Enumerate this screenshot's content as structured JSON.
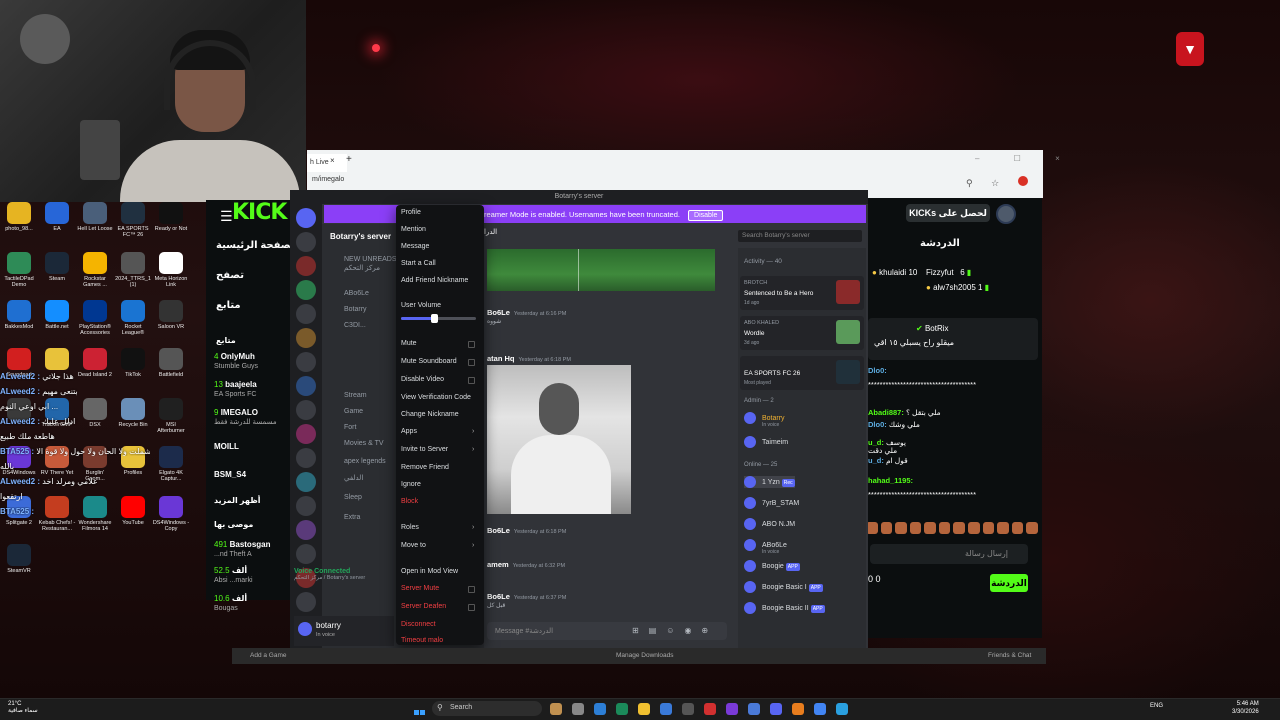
{
  "stream_overlay": {
    "corner_badge": "▼"
  },
  "desktop_icons": [
    {
      "label": "photo_98...",
      "color": "#e6b422"
    },
    {
      "label": "EA",
      "color": "#2766d8"
    },
    {
      "label": "Hell Let Loose",
      "color": "#4a5f7a"
    },
    {
      "label": "EA SPORTS FC™ 26",
      "color": "#203040"
    },
    {
      "label": "Ready or Not",
      "color": "#111111"
    },
    {
      "label": "TactileDPad Demo",
      "color": "#2e8b57"
    },
    {
      "label": "Steam",
      "color": "#1b2838"
    },
    {
      "label": "Rockstar Games ...",
      "color": "#f5b400"
    },
    {
      "label": "2024_TTRS_1 (1)",
      "color": "#555555"
    },
    {
      "label": "Meta Horizon Link",
      "color": "#ffffff"
    },
    {
      "label": "BakkesMod",
      "color": "#1f6fd1"
    },
    {
      "label": "Battle.net",
      "color": "#148eff"
    },
    {
      "label": "PlayStation® Accessories",
      "color": "#003791"
    },
    {
      "label": "Rocket League®",
      "color": "#1a74d2"
    },
    {
      "label": "Saloon VR",
      "color": "#333333"
    },
    {
      "label": "Soundpad",
      "color": "#d21f1f"
    },
    {
      "label": "",
      "color": "#e8c23a"
    },
    {
      "label": "Dead Island 2",
      "color": "#cc2233"
    },
    {
      "label": "TikTok",
      "color": "#111111"
    },
    {
      "label": "Battlefield",
      "color": "#555555"
    },
    {
      "label": "",
      "color": "#3a3a3a"
    },
    {
      "label": "TrackerGMP",
      "color": "#2266aa"
    },
    {
      "label": "DSX",
      "color": "#666666"
    },
    {
      "label": "Recycle Bin",
      "color": "#6a8fb8"
    },
    {
      "label": "MSI Afterburner",
      "color": "#202020"
    },
    {
      "label": "DS4Windows",
      "color": "#6a37d6"
    },
    {
      "label": "RV There Yet",
      "color": "#c85a3a"
    },
    {
      "label": "Burglin' Gnom...",
      "color": "#7a3b2e"
    },
    {
      "label": "Profiles",
      "color": "#e8c23a"
    },
    {
      "label": "Elgato 4K Captur...",
      "color": "#1c2b4b"
    },
    {
      "label": "Splitgate 2",
      "color": "#3c6bd8"
    },
    {
      "label": "Kebab Chefs! - Restauran...",
      "color": "#c43d1f"
    },
    {
      "label": "Wondershare Filmora 14",
      "color": "#1b8a8a"
    },
    {
      "label": "YouTube",
      "color": "#ff0000"
    },
    {
      "label": "DS4Windows - Copy",
      "color": "#6a37d6"
    },
    {
      "label": "SteamVR",
      "color": "#1b2838"
    }
  ],
  "left_chat": [
    {
      "user": "ALweed2 :",
      "text": "هذا جلاتي"
    },
    {
      "user": "ALweed2 :",
      "text": "بتنعى مهيم"
    },
    {
      "user": "",
      "text": "ابي اوعي النوم ..."
    },
    {
      "user": "ALweed2 :",
      "text": "ادلل عليك"
    },
    {
      "user": "",
      "text": "هاطعة ملك طبيع"
    },
    {
      "user": "BTA525 :",
      "text": "لا شملت ولا الحان ولا حول ولا قوة الا"
    },
    {
      "user": "",
      "text": "بالله"
    },
    {
      "user": "ALweed2 :",
      "text": "علامي ومرلد اخد"
    },
    {
      "user": "",
      "text": "ارتقعوا"
    },
    {
      "user": "BTA525 :",
      "text": ""
    }
  ],
  "kick": {
    "logo": "KICK",
    "menu_icon": "☰",
    "nav": [
      "الصفحة الرئيسية",
      "تصفح",
      "متابع"
    ],
    "following_header": "متابع",
    "streams": [
      {
        "count": "4",
        "name": "OnlyMuh",
        "game": "Stumble Guys"
      },
      {
        "count": "13",
        "name": "baajeela",
        "game": "EA Sports FC"
      },
      {
        "count": "9",
        "name": "IMEGALO",
        "game": "مسمسة للدرشة فقط"
      },
      {
        "count": "",
        "name": "MOILL",
        "game": ""
      },
      {
        "count": "",
        "name": "BSM_S4",
        "game": ""
      },
      {
        "count": "",
        "name": "أظهر المزيد",
        "game": ""
      },
      {
        "count": "",
        "name": "موصى بها",
        "game": ""
      },
      {
        "count": "491",
        "name": "Bastosgan",
        "game": "...nd Theft A"
      },
      {
        "count": "52.5",
        "name": "ألف",
        "game": "Absi ...marki"
      },
      {
        "count": "10.6",
        "name": "ألف",
        "game": "Bougas"
      }
    ]
  },
  "browser": {
    "tab_label": "h Live",
    "tab_close": "×",
    "new_tab": "+",
    "address": "m/imegalo",
    "win_controls": "– ☐ ×",
    "toolbar_icons": [
      "⚲",
      "☆"
    ]
  },
  "kick_right": {
    "top_button": "KICKs لحصل على",
    "chat_title": "الدردشة",
    "leaders": [
      {
        "name": "khulaidi",
        "value": "10"
      },
      {
        "name": "Fizzyfut",
        "value": "6"
      },
      {
        "name": "alw7sh2005",
        "value": "1"
      }
    ],
    "pinned_user": "BotRix",
    "pinned_text": "ميقلو راح يسبلي ١٥ اقي",
    "messages": [
      {
        "user": "Dlo0:",
        "text": ""
      },
      {
        "user": "",
        "text": "*************************************"
      },
      {
        "user": "Abadi887:",
        "text": "ملي بتقل ؟"
      },
      {
        "user": "Dlo0:",
        "text": "ملي وشك"
      },
      {
        "user": "u_d:",
        "text": "يوسف"
      },
      {
        "user": "",
        "text": "ملي دقت"
      },
      {
        "user": "u_d:",
        "text": "قول ام"
      },
      {
        "user": "hahad_1195:",
        "text": ""
      },
      {
        "user": "",
        "text": "*************************************"
      }
    ],
    "input_placeholder": "إرسال رسالة",
    "bottom_stats": "0   0",
    "chat_button": "الدردشة"
  },
  "discord": {
    "window_title": "Botarry's server",
    "banner_text": "reamer Mode is enabled. Usernames have been truncated.",
    "banner_button": "Disable",
    "server_name": "Botarry's server",
    "channels": [
      "مركز التحكم",
      "NEW UNREADS",
      "ABo6Le",
      "Botarry",
      "C3DI...",
      "Stream",
      "Game",
      "Fort",
      "Movies & TV",
      "apex legends",
      "الدلفي",
      "Sleep",
      "Extra"
    ],
    "voice_connected": "Voice Connected",
    "voice_sub": "مركز التحكم / Botarry's server",
    "user_name": "botarry",
    "user_status": "In voice",
    "channel_head": "الدرا",
    "search_placeholder": "Search Botarry's server",
    "messages": [
      {
        "author": "Bo6Le",
        "time": "Yesterday at 6:16 PM",
        "text": "شووه"
      },
      {
        "author": "atan Hq",
        "time": "Yesterday at 6:18 PM",
        "text": ""
      },
      {
        "author": "Bo6Le",
        "time": "Yesterday at 6:18 PM",
        "text": ""
      },
      {
        "author": "amem",
        "time": "Yesterday at 6:32 PM",
        "text": ""
      },
      {
        "author": "Bo6Le",
        "time": "Yesterday at 6:37 PM",
        "text": "قبل كل"
      }
    ],
    "input_placeholder": "Message #الدردشة",
    "input_icons": [
      "⊞",
      "▤",
      "☺",
      "◉",
      "⊕"
    ]
  },
  "context_menu": {
    "items": [
      {
        "label": "Profile",
        "type": "item"
      },
      {
        "label": "Mention",
        "type": "item"
      },
      {
        "label": "Message",
        "type": "item"
      },
      {
        "label": "Start a Call",
        "type": "item"
      },
      {
        "label": "Add Friend Nickname",
        "type": "item"
      },
      {
        "label": "User Volume",
        "type": "slider",
        "value": 0.44
      },
      {
        "label": "Mute",
        "type": "check"
      },
      {
        "label": "Mute Soundboard",
        "type": "check"
      },
      {
        "label": "Disable Video",
        "type": "check"
      },
      {
        "label": "View Verification Code",
        "type": "item"
      },
      {
        "label": "Change Nickname",
        "type": "item"
      },
      {
        "label": "Apps",
        "type": "submenu"
      },
      {
        "label": "Invite to Server",
        "type": "submenu"
      },
      {
        "label": "Remove Friend",
        "type": "item"
      },
      {
        "label": "Ignore",
        "type": "item"
      },
      {
        "label": "Block",
        "type": "danger"
      },
      {
        "label": "Roles",
        "type": "submenu"
      },
      {
        "label": "Move to",
        "type": "submenu"
      },
      {
        "label": "Open in Mod View",
        "type": "item"
      },
      {
        "label": "Server Mute",
        "type": "danger-check"
      },
      {
        "label": "Server Deafen",
        "type": "danger-check"
      },
      {
        "label": "Disconnect",
        "type": "danger"
      },
      {
        "label": "Timeout malo",
        "type": "danger"
      }
    ]
  },
  "members": {
    "activity_title": "Activity — 40",
    "activities": [
      {
        "l1": "BROTCH",
        "l2": "Sentenced to Be a Hero",
        "l3": "1d ago",
        "color": "#8a2a2a"
      },
      {
        "l1": "ABO KHALED",
        "l2": "Wordle",
        "l3": "3d ago",
        "color": "#5a9a5a"
      },
      {
        "l1": "",
        "l2": "EA SPORTS FC 26",
        "l3": "Most played",
        "color": "#20303a"
      }
    ],
    "admin_header": "Admin — 2",
    "admins": [
      {
        "name": "Botarry",
        "sub": "In voice",
        "gold": true
      },
      {
        "name": "Taimeim",
        "sub": ""
      }
    ],
    "online_header": "Online — 25",
    "online": [
      {
        "name": "1 Yzn",
        "sub": "",
        "tag": "Rec"
      },
      {
        "name": "7yrB_STAM",
        "sub": "",
        "tag": ""
      },
      {
        "name": "ABO N.JM",
        "sub": "",
        "tag": ""
      },
      {
        "name": "ABo6Le",
        "sub": "In voice",
        "tag": ""
      },
      {
        "name": "Boogie",
        "sub": "",
        "tag": "APP"
      },
      {
        "name": "Boogie Basic I",
        "sub": "",
        "tag": "APP"
      },
      {
        "name": "Boogie Basic II",
        "sub": "",
        "tag": "APP"
      }
    ]
  },
  "app_bottom": {
    "left": "Add a Game",
    "center": "Manage Downloads",
    "right": "Friends & Chat"
  },
  "taskbar": {
    "weather_temp": "21°C",
    "weather_desc": "سماء صافية",
    "search_label": "Search",
    "tray_lang": "ENG",
    "time": "5:46 AM",
    "date": "3/30/2026"
  }
}
